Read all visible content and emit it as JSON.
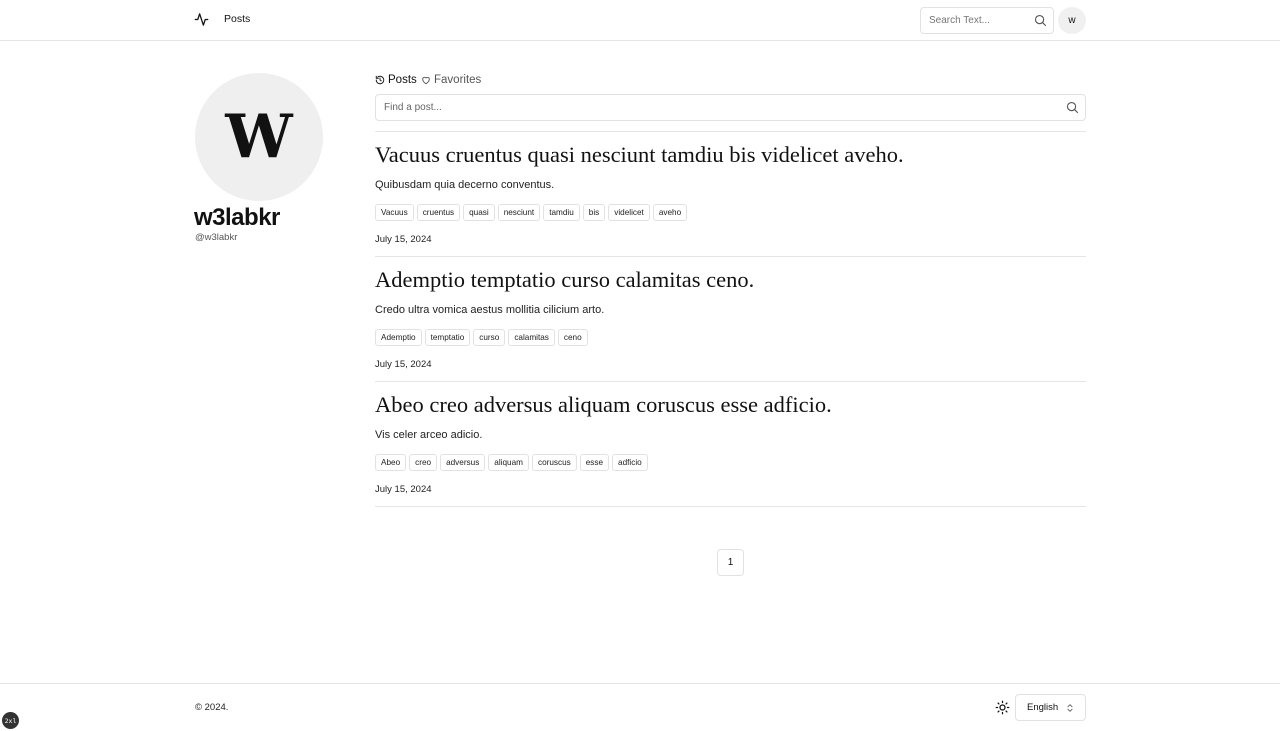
{
  "header": {
    "logo_icon": "activity-icon",
    "nav_posts": "Posts",
    "search_placeholder": "Search Text...",
    "avatar_letter": "w"
  },
  "profile": {
    "avatar_letter": "W",
    "username": "w3labkr",
    "handle": "@w3labkr"
  },
  "tabs": {
    "posts": "Posts",
    "favorites": "Favorites"
  },
  "post_search": {
    "placeholder": "Find a post..."
  },
  "posts": [
    {
      "title": "Vacuus cruentus quasi nesciunt tamdiu bis videlicet aveho.",
      "summary": "Quibusdam quia decerno conventus.",
      "tags": [
        "Vacuus",
        "cruentus",
        "quasi",
        "nesciunt",
        "tamdiu",
        "bis",
        "videlicet",
        "aveho"
      ],
      "date": "July 15, 2024"
    },
    {
      "title": "Ademptio temptatio curso calamitas ceno.",
      "summary": "Credo ultra vomica aestus mollitia cilicium arto.",
      "tags": [
        "Ademptio",
        "temptatio",
        "curso",
        "calamitas",
        "ceno"
      ],
      "date": "July 15, 2024"
    },
    {
      "title": "Abeo creo adversus aliquam coruscus esse adficio.",
      "summary": "Vis celer arceo adicio.",
      "tags": [
        "Abeo",
        "creo",
        "adversus",
        "aliquam",
        "coruscus",
        "esse",
        "adficio"
      ],
      "date": "July 15, 2024"
    }
  ],
  "pagination": {
    "current": "1"
  },
  "footer": {
    "copyright": "© 2024.",
    "language": "English",
    "theme_icon": "sun-icon"
  },
  "corner_badge": "2xl"
}
